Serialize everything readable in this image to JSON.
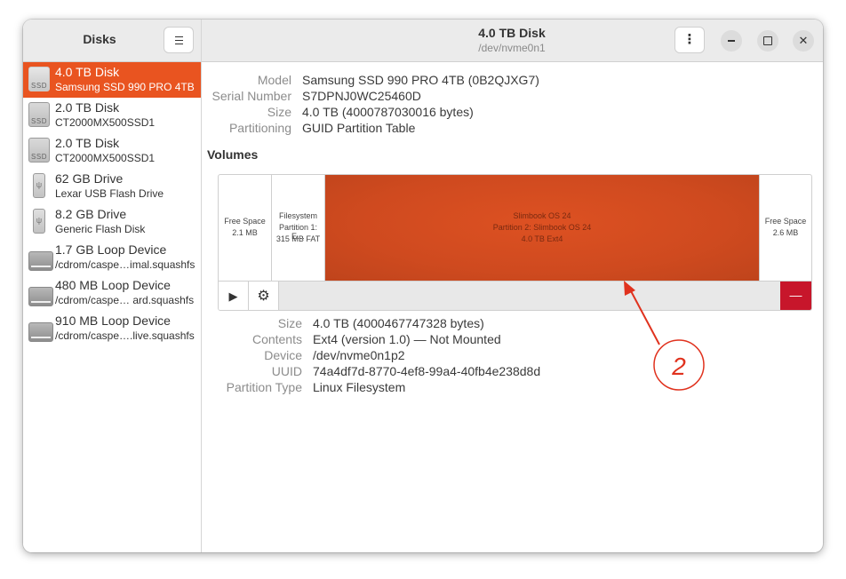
{
  "sidebar": {
    "title": "Disks",
    "menu_icon": "hamburger-menu-icon",
    "disks": [
      {
        "name": "4.0 TB Disk",
        "sub": "Samsung SSD 990 PRO 4TB",
        "icon": "ssd-icon",
        "icon_label": "SSD",
        "selected": true
      },
      {
        "name": "2.0 TB Disk",
        "sub": "CT2000MX500SSD1",
        "icon": "ssd-icon",
        "icon_label": "SSD"
      },
      {
        "name": "2.0 TB Disk",
        "sub": "CT2000MX500SSD1",
        "icon": "ssd-icon",
        "icon_label": "SSD"
      },
      {
        "name": "62 GB Drive",
        "sub": "Lexar USB Flash Drive",
        "icon": "usb-drive-icon"
      },
      {
        "name": "8.2 GB Drive",
        "sub": "Generic Flash Disk",
        "icon": "usb-drive-icon"
      },
      {
        "name": "1.7 GB Loop Device",
        "sub": "/cdrom/caspe…imal.squashfs",
        "icon": "loop-device-icon"
      },
      {
        "name": "480 MB Loop Device",
        "sub": "/cdrom/caspe… ard.squashfs",
        "icon": "loop-device-icon"
      },
      {
        "name": "910 MB Loop Device",
        "sub": "/cdrom/caspe….live.squashfs",
        "icon": "loop-device-icon"
      }
    ]
  },
  "header": {
    "title": "4.0 TB Disk",
    "subtitle": "/dev/nvme0n1",
    "menu_label": "⋮"
  },
  "disk_info": {
    "model_label": "Model",
    "model_value": "Samsung SSD 990 PRO 4TB (0B2QJXG7)",
    "serial_label": "Serial Number",
    "serial_value": "S7DPNJ0WC25460D",
    "size_label": "Size",
    "size_value": "4.0 TB (4000787030016 bytes)",
    "partitioning_label": "Partitioning",
    "partitioning_value": "GUID Partition Table"
  },
  "volumes": {
    "heading": "Volumes",
    "partitions": {
      "free1": {
        "line1": "Free Space",
        "line2": "2.1 MB"
      },
      "fs": {
        "line1": "Filesystem",
        "line2": "Partition 1: E…",
        "line3": "315 MB FAT"
      },
      "main": {
        "line1": "Slimbook OS 24",
        "line2": "Partition 2: Slimbook OS 24",
        "line3": "4.0 TB Ext4"
      },
      "free2": {
        "line1": "Free Space",
        "line2": "2.6 MB"
      }
    },
    "toolbar": {
      "play_icon": "play-icon",
      "gear_icon": "gear-icon",
      "delete_label": "—"
    }
  },
  "partition_info": {
    "size_label": "Size",
    "size_value": "4.0 TB (4000467747328 bytes)",
    "contents_label": "Contents",
    "contents_value": "Ext4 (version 1.0) — Not Mounted",
    "device_label": "Device",
    "device_value": "/dev/nvme0n1p2",
    "uuid_label": "UUID",
    "uuid_value": "74a4df7d-8770-4ef8-99a4-40fb4e238d8d",
    "type_label": "Partition Type",
    "type_value": "Linux Filesystem"
  },
  "annotation": {
    "number": "2"
  },
  "colors": {
    "accent": "#e95420",
    "partition_fill": "#d24b1f",
    "destructive": "#c7162b",
    "annotation_red": "#e0321e"
  }
}
